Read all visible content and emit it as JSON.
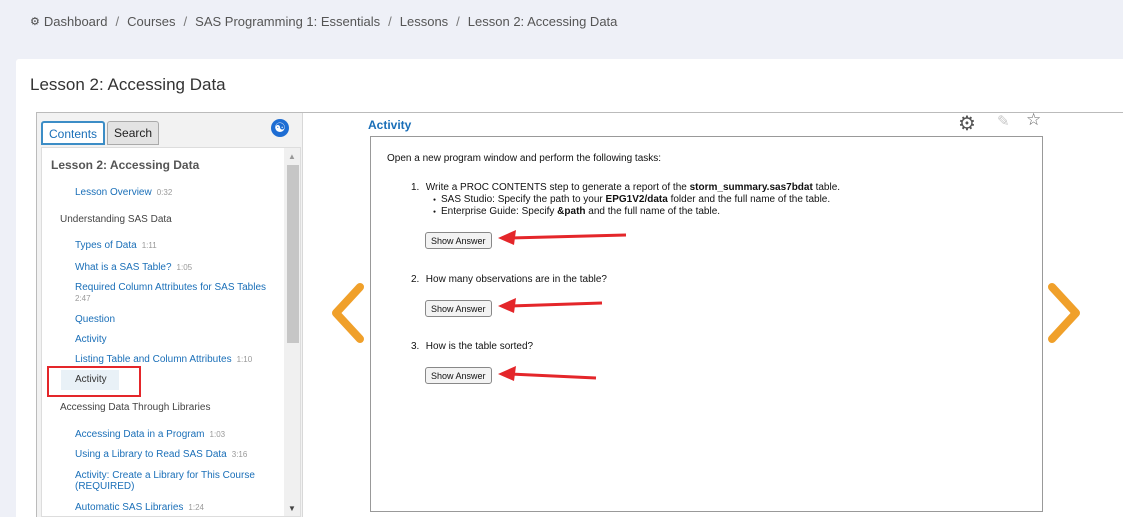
{
  "breadcrumb": {
    "items": [
      "Dashboard",
      "Courses",
      "SAS Programming 1: Essentials",
      "Lessons",
      "Lesson 2: Accessing Data"
    ],
    "separator": "/"
  },
  "page": {
    "title": "Lesson 2: Accessing Data"
  },
  "sidebar": {
    "tabs": {
      "contents": "Contents",
      "search": "Search"
    },
    "accessibility_icon": "accessibility-icon",
    "heading": "Lesson 2: Accessing Data",
    "items": [
      {
        "label": "Lesson Overview",
        "duration": "0:32"
      },
      {
        "label": "Understanding SAS Data",
        "duration": ""
      },
      {
        "label": "Types of Data",
        "duration": "1:11"
      },
      {
        "label": "What is a SAS Table?",
        "duration": "1:05"
      },
      {
        "label": "Required Column Attributes for SAS Tables",
        "duration": "2:47"
      },
      {
        "label": "Question",
        "duration": ""
      },
      {
        "label": "Activity",
        "duration": ""
      },
      {
        "label": "Listing Table and Column Attributes",
        "duration": "1:10"
      },
      {
        "label": "Activity",
        "duration": ""
      },
      {
        "label": "Accessing Data Through Libraries",
        "duration": ""
      },
      {
        "label": "Accessing Data in a Program",
        "duration": "1:03"
      },
      {
        "label": "Using a Library to Read SAS Data",
        "duration": "3:16"
      },
      {
        "label": "Activity: Create a Library for This Course",
        "label2": "(REQUIRED)",
        "duration": ""
      },
      {
        "label": "Automatic SAS Libraries",
        "duration": "1:24"
      }
    ]
  },
  "main": {
    "title": "Activity",
    "toolbar_icons": [
      "gear-icon",
      "pencil-icon",
      "star-icon"
    ],
    "intro": "Open a new program window and perform the following tasks:",
    "questions": [
      {
        "number": "1.",
        "text_before": "Write a PROC CONTENTS step to generate a report of the ",
        "bold": "storm_summary.sas7bdat",
        "text_after": " table.",
        "bullets": [
          {
            "before": "SAS Studio: Specify the path to your ",
            "bold": "EPG1V2/data",
            "after": " folder and the full name of the table."
          },
          {
            "before": "Enterprise Guide: Specify ",
            "bold": "&path",
            "after": " and the full name of the table."
          }
        ]
      },
      {
        "number": "2.",
        "text": "How many observations are in the table?"
      },
      {
        "number": "3.",
        "text": "How is the table sorted?"
      }
    ],
    "show_answer_label": "Show Answer"
  },
  "colors": {
    "accent": "#1a6fb8",
    "nav_arrow": "#f0a02a",
    "annotation": "#e4262a"
  }
}
